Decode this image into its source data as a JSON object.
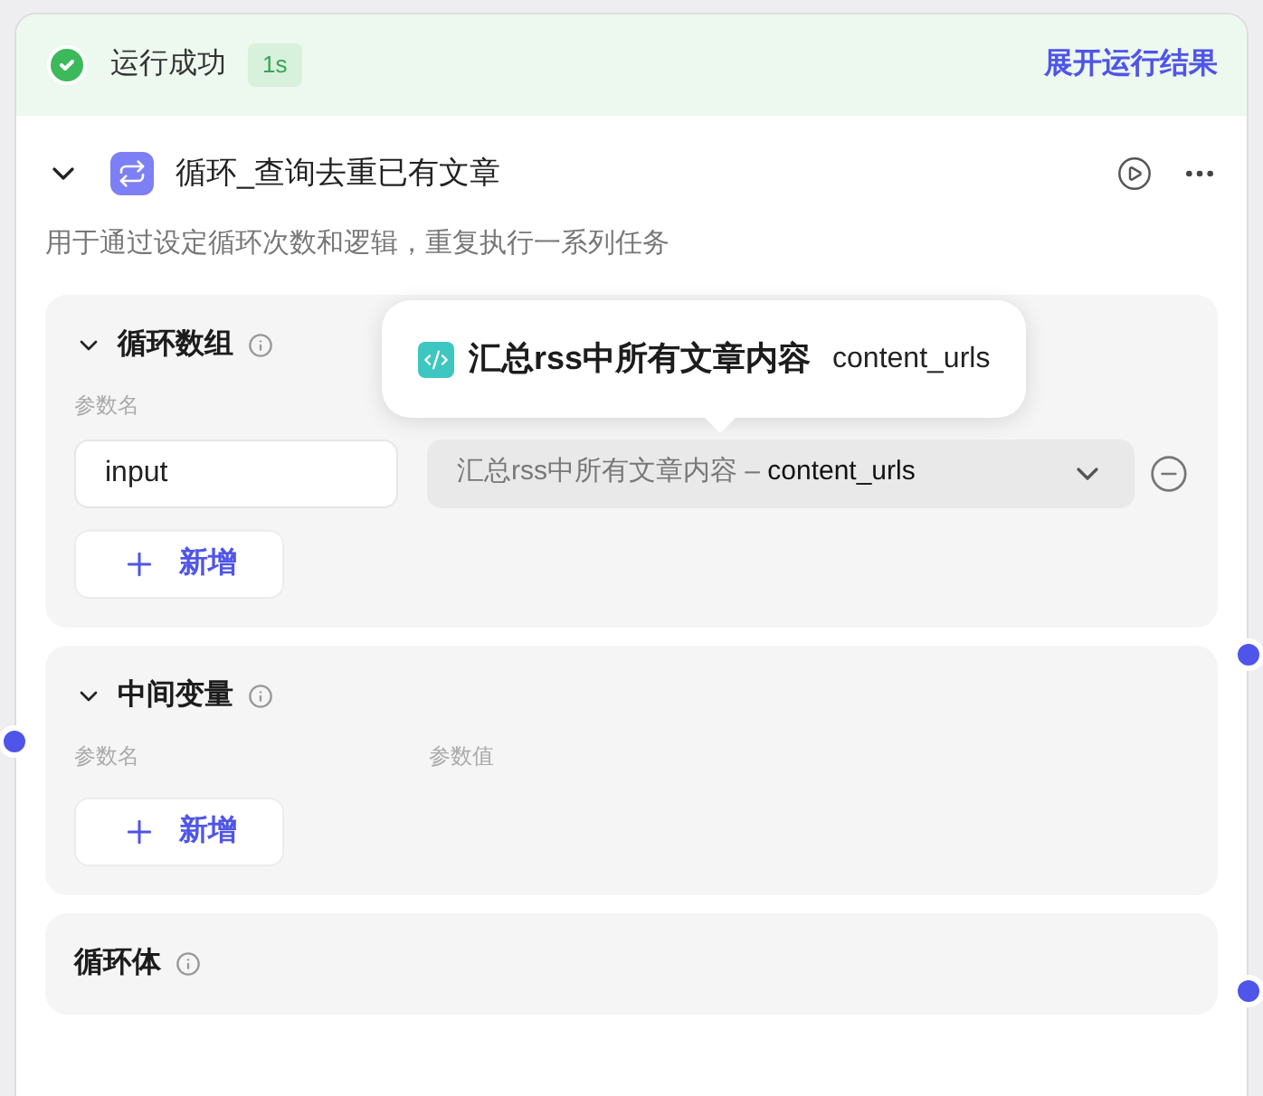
{
  "status": {
    "label": "运行成功",
    "duration": "1s",
    "link": "展开运行结果"
  },
  "node": {
    "title": "循环_查询去重已有文章",
    "expanded": true,
    "description": "用于通过设定循环次数和逻辑，重复执行一系列任务"
  },
  "tooltip": {
    "source": "汇总rss中所有文章内容",
    "variable": "content_urls"
  },
  "sections": [
    {
      "title": "循环数组",
      "expanded": true,
      "columns": [
        "参数名"
      ],
      "rows": [
        {
          "name": "input",
          "source": "汇总rss中所有文章内容",
          "sep": " – ",
          "variable": "content_urls"
        }
      ],
      "add": "新增"
    },
    {
      "title": "中间变量",
      "expanded": true,
      "columns": [
        "参数名",
        "参数值"
      ],
      "add": "新增"
    },
    {
      "title": "循环体"
    }
  ]
}
